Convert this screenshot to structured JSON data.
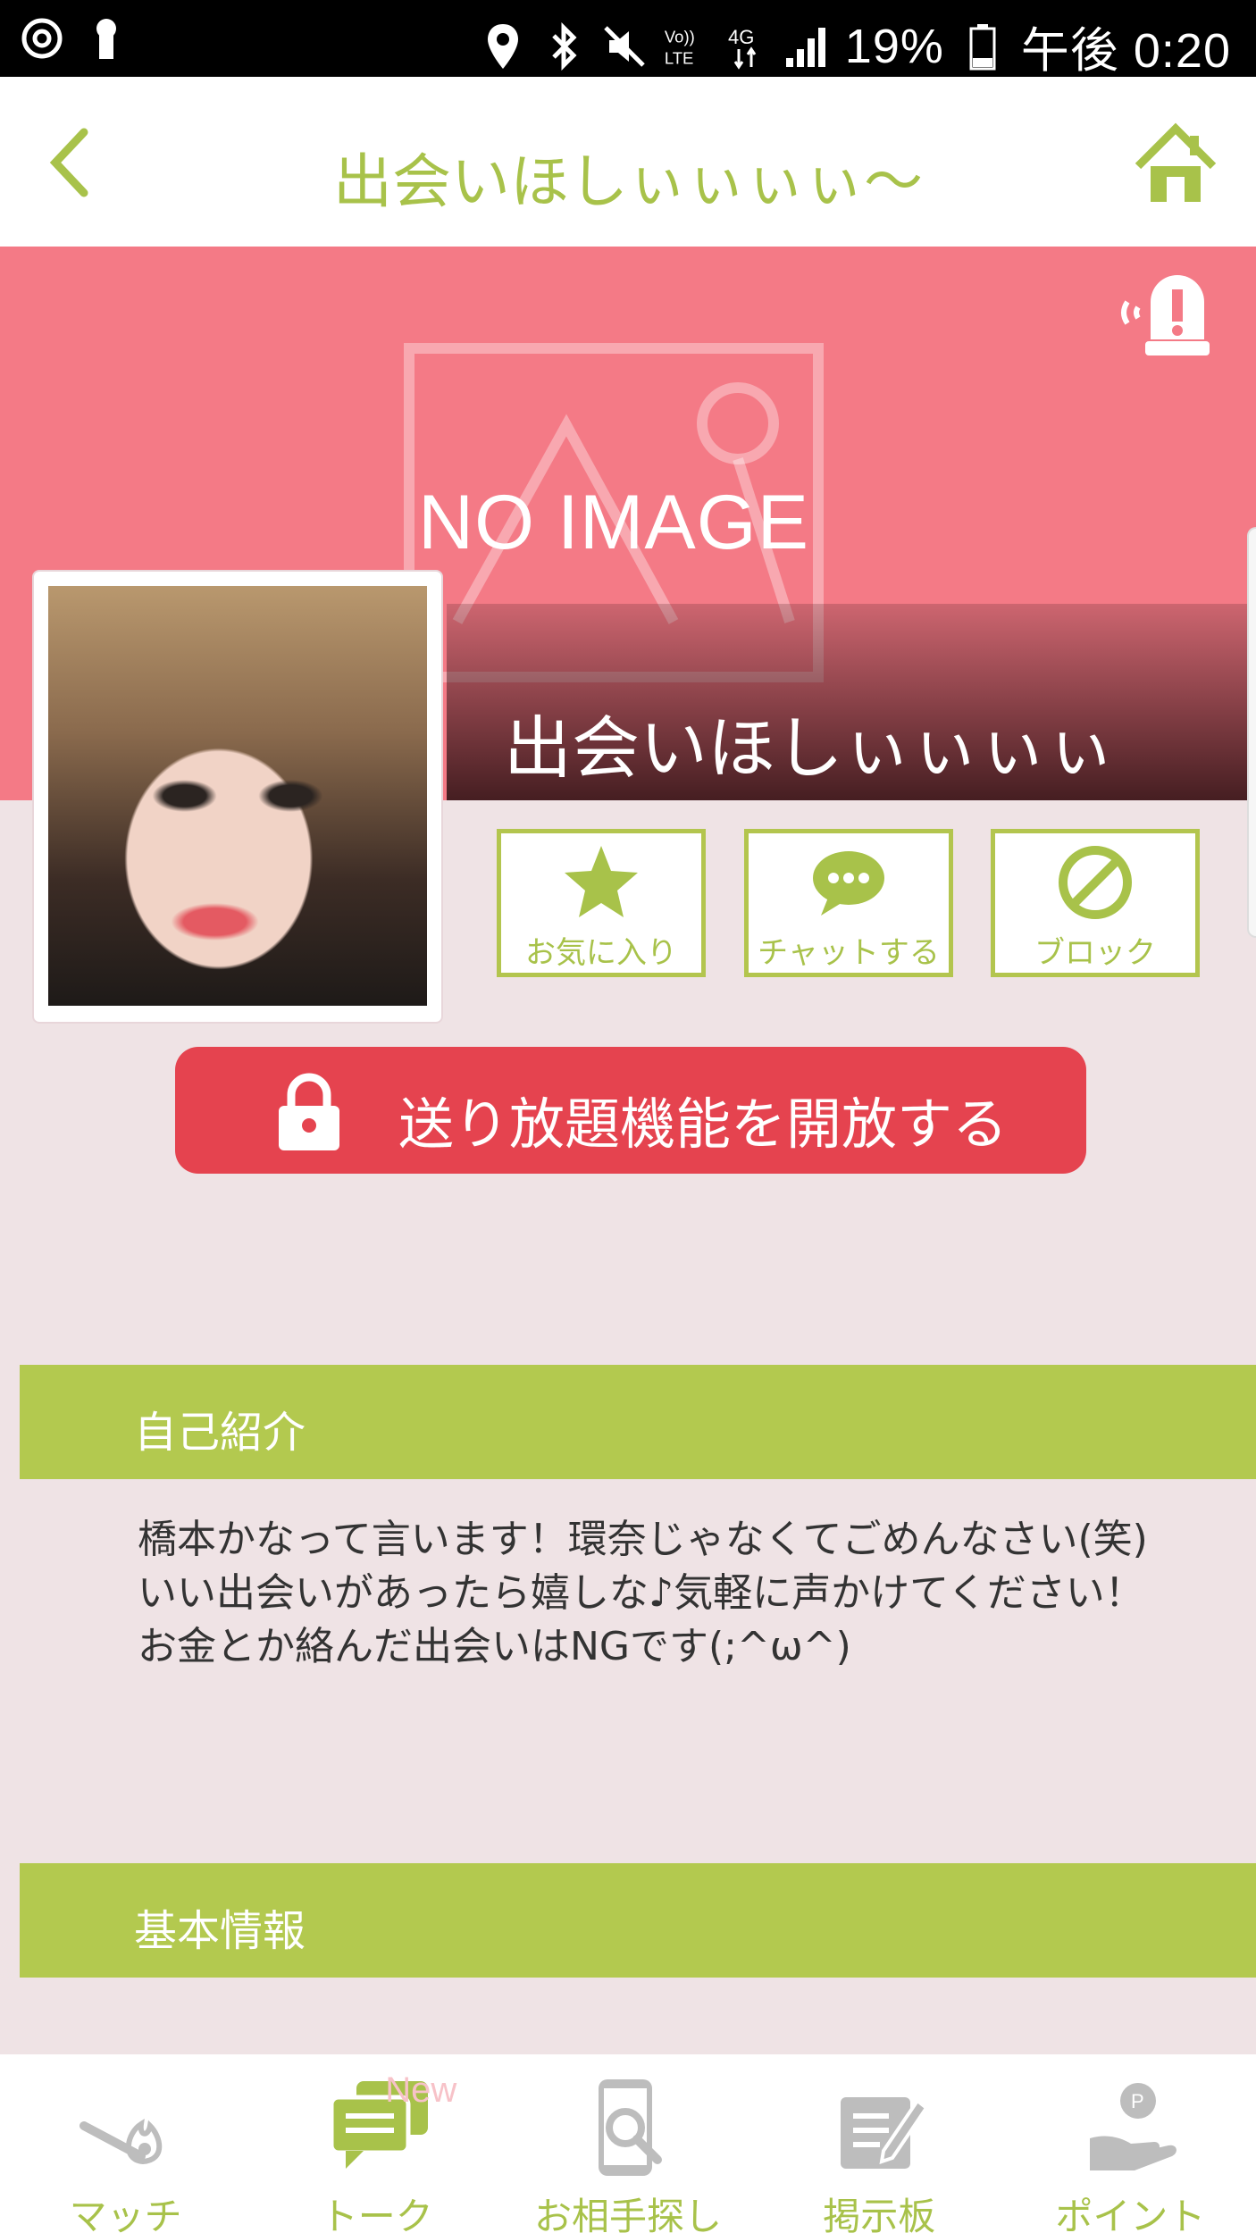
{
  "status_bar": {
    "battery": "19%",
    "time": "午後 0:20",
    "network": "4G"
  },
  "header": {
    "title": "出会いほしぃぃぃぃ〜"
  },
  "cover": {
    "placeholder_text": "NO IMAGE",
    "profile_name": "出会いほしぃぃぃぃ"
  },
  "actions": [
    {
      "label": "お気に入り",
      "icon": "star-icon"
    },
    {
      "label": "チャットする",
      "icon": "chat-bubble-icon"
    },
    {
      "label": "ブロック",
      "icon": "block-icon"
    }
  ],
  "unlock_button": {
    "label": "送り放題機能を開放する"
  },
  "sections": {
    "intro_title": "自己紹介",
    "intro_lines": [
      "橋本かなって言います！環奈じゃなくてごめんなさい(笑)",
      "いい出会いがあったら嬉しな♪気軽に声かけてください！",
      "お金とか絡んだ出会いはNGです(;^ω^)"
    ],
    "basic_title": "基本情報"
  },
  "bottom_nav": [
    {
      "label": "マッチ",
      "icon": "match-icon"
    },
    {
      "label": "トーク",
      "icon": "talk-icon",
      "badge": "New"
    },
    {
      "label": "お相手探し",
      "icon": "search-phone-icon"
    },
    {
      "label": "掲示板",
      "icon": "bulletin-board-icon"
    },
    {
      "label": "ポイント",
      "icon": "point-hand-icon"
    }
  ],
  "colors": {
    "accent": "#a8c24a",
    "cover": "#f47a86",
    "unlock": "#e5434f",
    "background": "#efe3e5"
  }
}
